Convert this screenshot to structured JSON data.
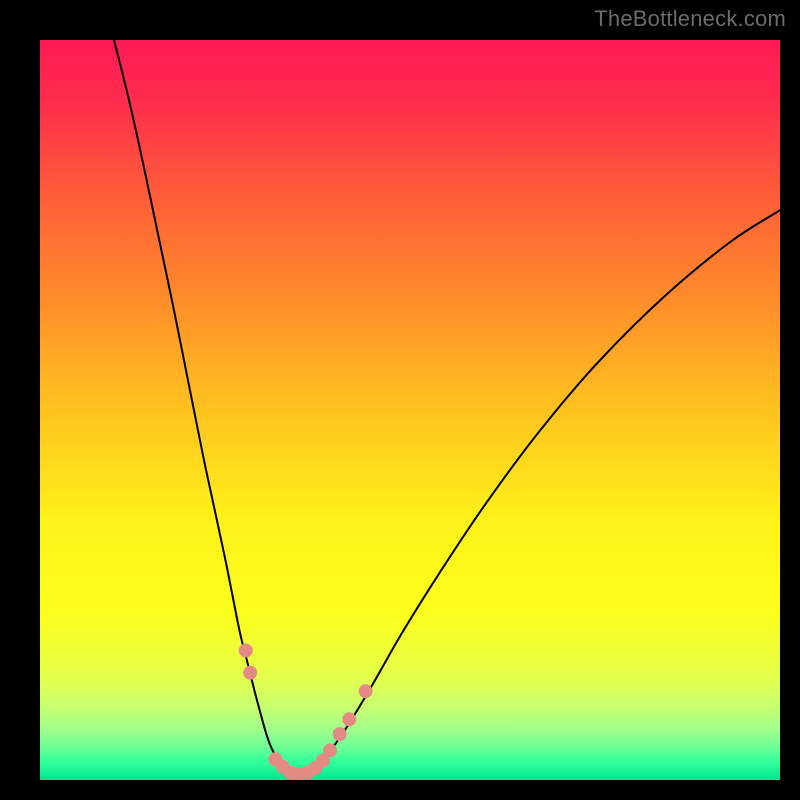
{
  "watermark": "TheBottleneck.com",
  "chart_data": {
    "type": "line",
    "title": "",
    "xlabel": "",
    "ylabel": "",
    "xlim": [
      0,
      100
    ],
    "ylim": [
      0,
      100
    ],
    "grid": false,
    "legend": false,
    "background_gradient": {
      "stops": [
        {
          "offset": 0.0,
          "color": "#ff1a55"
        },
        {
          "offset": 0.08,
          "color": "#ff2b4e"
        },
        {
          "offset": 0.2,
          "color": "#ff5a3a"
        },
        {
          "offset": 0.35,
          "color": "#ff8c2a"
        },
        {
          "offset": 0.5,
          "color": "#ffc31f"
        },
        {
          "offset": 0.65,
          "color": "#fff21a"
        },
        {
          "offset": 0.78,
          "color": "#fbff1e"
        },
        {
          "offset": 0.86,
          "color": "#e5ff4a"
        },
        {
          "offset": 0.9,
          "color": "#c7ff6e"
        },
        {
          "offset": 0.93,
          "color": "#a3ff8a"
        },
        {
          "offset": 0.955,
          "color": "#70ff96"
        },
        {
          "offset": 0.975,
          "color": "#34ff9a"
        },
        {
          "offset": 1.0,
          "color": "#00e58f"
        }
      ]
    },
    "series": [
      {
        "name": "left-branch",
        "stroke": "#000000",
        "x": [
          10.0,
          12.0,
          14.0,
          16.0,
          18.0,
          20.0,
          22.0,
          23.5,
          25.0,
          26.0,
          27.0,
          28.0,
          29.0,
          29.8,
          30.5,
          31.2,
          32.0,
          33.0,
          34.0
        ],
        "y": [
          100.0,
          92.0,
          83.0,
          73.5,
          64.0,
          54.0,
          44.0,
          37.0,
          30.0,
          25.0,
          20.0,
          16.0,
          12.0,
          9.0,
          6.5,
          4.5,
          3.0,
          1.5,
          0.5
        ]
      },
      {
        "name": "right-branch",
        "stroke": "#000000",
        "x": [
          36.0,
          37.0,
          38.5,
          40.0,
          42.0,
          45.0,
          49.0,
          54.0,
          60.0,
          67.0,
          75.0,
          84.0,
          93.0,
          100.0
        ],
        "y": [
          0.5,
          1.5,
          3.0,
          5.0,
          8.0,
          13.0,
          20.0,
          28.0,
          37.0,
          46.5,
          56.0,
          65.0,
          72.5,
          77.0
        ]
      }
    ],
    "markers": {
      "name": "salmon-dots",
      "color": "#e48a84",
      "radius_px": 7,
      "points": [
        {
          "x": 27.8,
          "y": 17.5
        },
        {
          "x": 28.4,
          "y": 14.5
        },
        {
          "x": 31.8,
          "y": 2.8
        },
        {
          "x": 32.8,
          "y": 1.8
        },
        {
          "x": 33.8,
          "y": 1.0
        },
        {
          "x": 35.0,
          "y": 0.8
        },
        {
          "x": 36.2,
          "y": 1.0
        },
        {
          "x": 37.2,
          "y": 1.6
        },
        {
          "x": 38.2,
          "y": 2.6
        },
        {
          "x": 39.2,
          "y": 4.0
        },
        {
          "x": 40.5,
          "y": 6.2
        },
        {
          "x": 41.8,
          "y": 8.2
        },
        {
          "x": 44.0,
          "y": 12.0
        }
      ]
    }
  }
}
